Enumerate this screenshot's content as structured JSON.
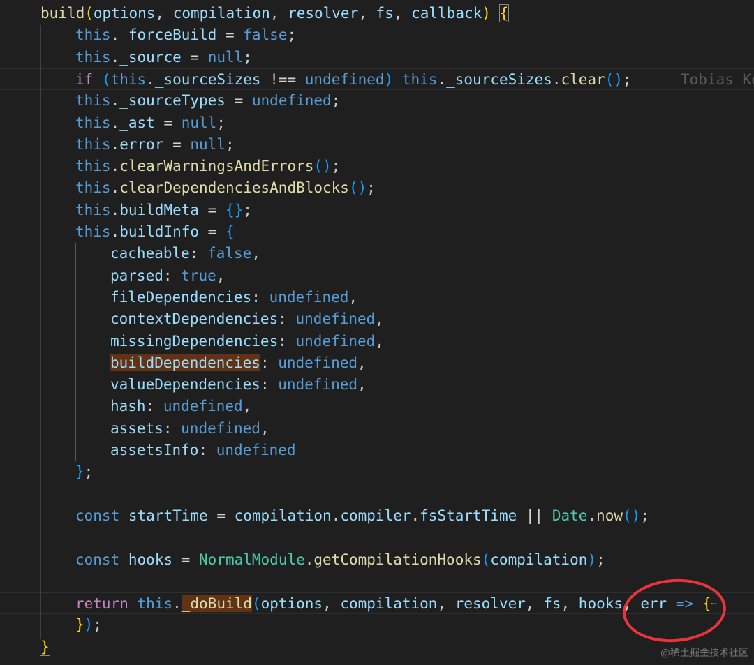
{
  "editor": {
    "lines": [
      {
        "indent": 1,
        "tokens": [
          {
            "t": "build",
            "c": "fn"
          },
          {
            "t": "(",
            "c": "p1"
          },
          {
            "t": "options",
            "c": "param"
          },
          {
            "t": ", ",
            "c": "plain"
          },
          {
            "t": "compilation",
            "c": "param"
          },
          {
            "t": ", ",
            "c": "plain"
          },
          {
            "t": "resolver",
            "c": "param"
          },
          {
            "t": ", ",
            "c": "plain"
          },
          {
            "t": "fs",
            "c": "param"
          },
          {
            "t": ", ",
            "c": "plain"
          },
          {
            "t": "callback",
            "c": "param"
          },
          {
            "t": ")",
            "c": "p1"
          },
          {
            "t": " ",
            "c": "plain"
          },
          {
            "t": "{",
            "c": "p1",
            "box": true
          }
        ]
      },
      {
        "indent": 2,
        "tokens": [
          {
            "t": "this",
            "c": "this"
          },
          {
            "t": ".",
            "c": "plain"
          },
          {
            "t": "_forceBuild",
            "c": "prop"
          },
          {
            "t": " = ",
            "c": "op"
          },
          {
            "t": "false",
            "c": "kw"
          },
          {
            "t": ";",
            "c": "plain"
          }
        ]
      },
      {
        "indent": 2,
        "tokens": [
          {
            "t": "this",
            "c": "this"
          },
          {
            "t": ".",
            "c": "plain"
          },
          {
            "t": "_source",
            "c": "prop"
          },
          {
            "t": " = ",
            "c": "op"
          },
          {
            "t": "null",
            "c": "kw"
          },
          {
            "t": ";",
            "c": "plain"
          }
        ]
      },
      {
        "indent": 2,
        "current": true,
        "tokens": [
          {
            "t": "if",
            "c": "ctrl"
          },
          {
            "t": " ",
            "c": "plain"
          },
          {
            "t": "(",
            "c": "p3"
          },
          {
            "t": "this",
            "c": "this"
          },
          {
            "t": ".",
            "c": "plain"
          },
          {
            "t": "_sourceSizes",
            "c": "prop"
          },
          {
            "t": " !== ",
            "c": "op"
          },
          {
            "t": "undefined",
            "c": "kw"
          },
          {
            "t": ")",
            "c": "p3"
          },
          {
            "t": " ",
            "c": "plain"
          },
          {
            "t": "this",
            "c": "this"
          },
          {
            "t": ".",
            "c": "plain"
          },
          {
            "t": "_sourceSizes",
            "c": "prop"
          },
          {
            "t": ".",
            "c": "plain"
          },
          {
            "t": "clear",
            "c": "fn"
          },
          {
            "t": "()",
            "c": "p3"
          },
          {
            "t": ";",
            "c": "plain"
          }
        ]
      },
      {
        "indent": 2,
        "tokens": [
          {
            "t": "this",
            "c": "this"
          },
          {
            "t": ".",
            "c": "plain"
          },
          {
            "t": "_sourceTypes",
            "c": "prop"
          },
          {
            "t": " = ",
            "c": "op"
          },
          {
            "t": "undefined",
            "c": "kw"
          },
          {
            "t": ";",
            "c": "plain"
          }
        ]
      },
      {
        "indent": 2,
        "tokens": [
          {
            "t": "this",
            "c": "this"
          },
          {
            "t": ".",
            "c": "plain"
          },
          {
            "t": "_ast",
            "c": "prop"
          },
          {
            "t": " = ",
            "c": "op"
          },
          {
            "t": "null",
            "c": "kw"
          },
          {
            "t": ";",
            "c": "plain"
          }
        ]
      },
      {
        "indent": 2,
        "tokens": [
          {
            "t": "this",
            "c": "this"
          },
          {
            "t": ".",
            "c": "plain"
          },
          {
            "t": "error",
            "c": "prop"
          },
          {
            "t": " = ",
            "c": "op"
          },
          {
            "t": "null",
            "c": "kw"
          },
          {
            "t": ";",
            "c": "plain"
          }
        ]
      },
      {
        "indent": 2,
        "tokens": [
          {
            "t": "this",
            "c": "this"
          },
          {
            "t": ".",
            "c": "plain"
          },
          {
            "t": "clearWarningsAndErrors",
            "c": "fn"
          },
          {
            "t": "()",
            "c": "p3"
          },
          {
            "t": ";",
            "c": "plain"
          }
        ]
      },
      {
        "indent": 2,
        "tokens": [
          {
            "t": "this",
            "c": "this"
          },
          {
            "t": ".",
            "c": "plain"
          },
          {
            "t": "clearDependenciesAndBlocks",
            "c": "fn"
          },
          {
            "t": "()",
            "c": "p3"
          },
          {
            "t": ";",
            "c": "plain"
          }
        ]
      },
      {
        "indent": 2,
        "tokens": [
          {
            "t": "this",
            "c": "this"
          },
          {
            "t": ".",
            "c": "plain"
          },
          {
            "t": "buildMeta",
            "c": "prop"
          },
          {
            "t": " = ",
            "c": "op"
          },
          {
            "t": "{}",
            "c": "p3"
          },
          {
            "t": ";",
            "c": "plain"
          }
        ]
      },
      {
        "indent": 2,
        "tokens": [
          {
            "t": "this",
            "c": "this"
          },
          {
            "t": ".",
            "c": "plain"
          },
          {
            "t": "buildInfo",
            "c": "prop"
          },
          {
            "t": " = ",
            "c": "op"
          },
          {
            "t": "{",
            "c": "p3"
          }
        ]
      },
      {
        "indent": 3,
        "tokens": [
          {
            "t": "cacheable",
            "c": "prop"
          },
          {
            "t": ": ",
            "c": "plain"
          },
          {
            "t": "false",
            "c": "kw"
          },
          {
            "t": ",",
            "c": "plain"
          }
        ]
      },
      {
        "indent": 3,
        "tokens": [
          {
            "t": "parsed",
            "c": "prop"
          },
          {
            "t": ": ",
            "c": "plain"
          },
          {
            "t": "true",
            "c": "kw"
          },
          {
            "t": ",",
            "c": "plain"
          }
        ]
      },
      {
        "indent": 3,
        "tokens": [
          {
            "t": "fileDependencies",
            "c": "prop"
          },
          {
            "t": ": ",
            "c": "plain"
          },
          {
            "t": "undefined",
            "c": "kw"
          },
          {
            "t": ",",
            "c": "plain"
          }
        ]
      },
      {
        "indent": 3,
        "tokens": [
          {
            "t": "contextDependencies",
            "c": "prop"
          },
          {
            "t": ": ",
            "c": "plain"
          },
          {
            "t": "undefined",
            "c": "kw"
          },
          {
            "t": ",",
            "c": "plain"
          }
        ]
      },
      {
        "indent": 3,
        "tokens": [
          {
            "t": "missingDependencies",
            "c": "prop"
          },
          {
            "t": ": ",
            "c": "plain"
          },
          {
            "t": "undefined",
            "c": "kw"
          },
          {
            "t": ",",
            "c": "plain"
          }
        ]
      },
      {
        "indent": 3,
        "tokens": [
          {
            "t": "buildDependencies",
            "c": "prop",
            "hl": true
          },
          {
            "t": ": ",
            "c": "plain"
          },
          {
            "t": "undefined",
            "c": "kw"
          },
          {
            "t": ",",
            "c": "plain"
          }
        ]
      },
      {
        "indent": 3,
        "tokens": [
          {
            "t": "valueDependencies",
            "c": "prop"
          },
          {
            "t": ": ",
            "c": "plain"
          },
          {
            "t": "undefined",
            "c": "kw"
          },
          {
            "t": ",",
            "c": "plain"
          }
        ]
      },
      {
        "indent": 3,
        "tokens": [
          {
            "t": "hash",
            "c": "prop"
          },
          {
            "t": ": ",
            "c": "plain"
          },
          {
            "t": "undefined",
            "c": "kw"
          },
          {
            "t": ",",
            "c": "plain"
          }
        ]
      },
      {
        "indent": 3,
        "tokens": [
          {
            "t": "assets",
            "c": "prop"
          },
          {
            "t": ": ",
            "c": "plain"
          },
          {
            "t": "undefined",
            "c": "kw"
          },
          {
            "t": ",",
            "c": "plain"
          }
        ]
      },
      {
        "indent": 3,
        "tokens": [
          {
            "t": "assetsInfo",
            "c": "prop"
          },
          {
            "t": ": ",
            "c": "plain"
          },
          {
            "t": "undefined",
            "c": "kw"
          }
        ]
      },
      {
        "indent": 2,
        "tokens": [
          {
            "t": "}",
            "c": "p3"
          },
          {
            "t": ";",
            "c": "plain"
          }
        ]
      },
      {
        "indent": 2,
        "tokens": []
      },
      {
        "indent": 2,
        "tokens": [
          {
            "t": "const",
            "c": "kw"
          },
          {
            "t": " ",
            "c": "plain"
          },
          {
            "t": "startTime",
            "c": "param"
          },
          {
            "t": " = ",
            "c": "op"
          },
          {
            "t": "compilation",
            "c": "param"
          },
          {
            "t": ".",
            "c": "plain"
          },
          {
            "t": "compiler",
            "c": "prop"
          },
          {
            "t": ".",
            "c": "plain"
          },
          {
            "t": "fsStartTime",
            "c": "prop"
          },
          {
            "t": " || ",
            "c": "op"
          },
          {
            "t": "Date",
            "c": "class"
          },
          {
            "t": ".",
            "c": "plain"
          },
          {
            "t": "now",
            "c": "fn"
          },
          {
            "t": "()",
            "c": "p3"
          },
          {
            "t": ";",
            "c": "plain"
          }
        ]
      },
      {
        "indent": 2,
        "tokens": []
      },
      {
        "indent": 2,
        "tokens": [
          {
            "t": "const",
            "c": "kw"
          },
          {
            "t": " ",
            "c": "plain"
          },
          {
            "t": "hooks",
            "c": "param"
          },
          {
            "t": " = ",
            "c": "op"
          },
          {
            "t": "NormalModule",
            "c": "class"
          },
          {
            "t": ".",
            "c": "plain"
          },
          {
            "t": "getCompilationHooks",
            "c": "fn"
          },
          {
            "t": "(",
            "c": "p3"
          },
          {
            "t": "compilation",
            "c": "param"
          },
          {
            "t": ")",
            "c": "p3"
          },
          {
            "t": ";",
            "c": "plain"
          }
        ]
      },
      {
        "indent": 2,
        "tokens": []
      },
      {
        "indent": 2,
        "current": true,
        "tokens": [
          {
            "t": "return",
            "c": "ctrl"
          },
          {
            "t": " ",
            "c": "plain"
          },
          {
            "t": "this",
            "c": "this"
          },
          {
            "t": ".",
            "c": "plain"
          },
          {
            "t": "_doBuild",
            "c": "fn",
            "hl": true
          },
          {
            "t": "(",
            "c": "p3"
          },
          {
            "t": "options",
            "c": "param"
          },
          {
            "t": ", ",
            "c": "plain"
          },
          {
            "t": "compilation",
            "c": "param"
          },
          {
            "t": ", ",
            "c": "plain"
          },
          {
            "t": "resolver",
            "c": "param"
          },
          {
            "t": ", ",
            "c": "plain"
          },
          {
            "t": "fs",
            "c": "param"
          },
          {
            "t": ", ",
            "c": "plain"
          },
          {
            "t": "hooks",
            "c": "param"
          },
          {
            "t": ", ",
            "c": "plain"
          },
          {
            "t": "err",
            "c": "param"
          },
          {
            "t": " => ",
            "c": "kw"
          },
          {
            "t": "{",
            "c": "p1"
          },
          {
            "t": "⋯",
            "c": "fold"
          }
        ]
      },
      {
        "indent": 2,
        "tokens": [
          {
            "t": "}",
            "c": "p1"
          },
          {
            "t": ")",
            "c": "p3"
          },
          {
            "t": ";",
            "c": "plain"
          }
        ]
      },
      {
        "indent": 1,
        "tokens": [
          {
            "t": "}",
            "c": "p1",
            "box": true
          }
        ]
      }
    ],
    "blame": "Tobias Ko"
  },
  "watermark": "@稀土掘金技术社区"
}
